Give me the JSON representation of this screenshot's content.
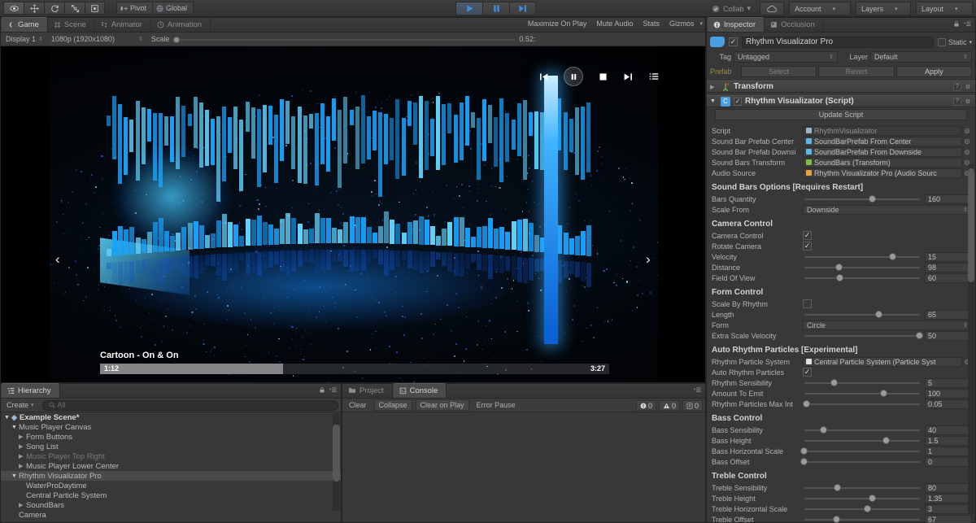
{
  "toolbar": {
    "tools": [
      "hand-tool",
      "move-tool",
      "rotate-tool",
      "scale-tool",
      "rect-tool"
    ],
    "pivot_label": "Pivot",
    "global_label": "Global",
    "play_label": "play",
    "pause_label": "pause",
    "step_label": "step",
    "collab_label": "Collab",
    "cloud_label": "cloud-services",
    "account_label": "Account",
    "layers_label": "Layers",
    "layout_label": "Layout",
    "caret": "▾"
  },
  "game": {
    "tabs": [
      {
        "label": "Game",
        "icon": "game-icon",
        "active": true
      },
      {
        "label": "Scene",
        "icon": "scene-icon",
        "active": false
      },
      {
        "label": "Animator",
        "icon": "animator-icon",
        "active": false
      },
      {
        "label": "Animation",
        "icon": "animation-icon",
        "active": false
      }
    ],
    "display": "Display 1",
    "resolution": "1080p (1920x1080)",
    "scale_label": "Scale",
    "scale_value": "0.52:",
    "maximize_on_play": "Maximize On Play",
    "mute_audio": "Mute Audio",
    "stats": "Stats",
    "gizmos": "Gizmos",
    "player": {
      "song_title": "Cartoon - On & On",
      "current_time": "1:12",
      "total_time": "3:27",
      "progress_percent": 36,
      "controls": [
        "previous-icon",
        "pause-icon",
        "stop-icon",
        "next-icon",
        "playlist-icon"
      ]
    },
    "nav_left": "‹",
    "nav_right": "›"
  },
  "hierarchy": {
    "tab_label": "Hierarchy",
    "create_label": "Create",
    "search_placeholder": "All",
    "items": [
      {
        "label": "Example Scene*",
        "depth": 0,
        "arrow": "open",
        "style": "scene"
      },
      {
        "label": "Music Player Canvas",
        "depth": 1,
        "arrow": "open",
        "style": "normal"
      },
      {
        "label": "Form Buttons",
        "depth": 2,
        "arrow": "closed",
        "style": "normal"
      },
      {
        "label": "Song List",
        "depth": 2,
        "arrow": "closed",
        "style": "normal"
      },
      {
        "label": "Music Player Top Right",
        "depth": 2,
        "arrow": "closed",
        "style": "dim"
      },
      {
        "label": "Music Player Lower Center",
        "depth": 2,
        "arrow": "closed",
        "style": "normal"
      },
      {
        "label": "Rhythm Visualizator Pro",
        "depth": 1,
        "arrow": "open",
        "style": "selected"
      },
      {
        "label": "WaterProDaytime",
        "depth": 2,
        "arrow": "none",
        "style": "normal"
      },
      {
        "label": "Central Particle System",
        "depth": 2,
        "arrow": "none",
        "style": "normal"
      },
      {
        "label": "SoundBars",
        "depth": 2,
        "arrow": "closed",
        "style": "normal"
      },
      {
        "label": "Camera",
        "depth": 1,
        "arrow": "none",
        "style": "normal"
      }
    ]
  },
  "console": {
    "tabs": [
      {
        "label": "Project",
        "icon": "folder-icon",
        "active": false
      },
      {
        "label": "Console",
        "icon": "console-icon",
        "active": true
      }
    ],
    "clear": "Clear",
    "collapse": "Collapse",
    "clear_on_play": "Clear on Play",
    "error_pause": "Error Pause",
    "counts": [
      {
        "icon": "error-icon",
        "value": "0"
      },
      {
        "icon": "warning-icon",
        "value": "0"
      },
      {
        "icon": "info-icon",
        "value": "0"
      }
    ]
  },
  "inspector": {
    "tabs": [
      {
        "label": "Inspector",
        "icon": "inspector-icon",
        "active": true
      },
      {
        "label": "Occlusion",
        "icon": "occlusion-icon",
        "active": false
      }
    ],
    "object_name": "Rhythm Visualizator Pro",
    "enabled": true,
    "static_label": "Static",
    "tag_label": "Tag",
    "tag_value": "Untagged",
    "layer_label": "Layer",
    "layer_value": "Default",
    "prefab_label": "Prefab",
    "prefab_select": "Select",
    "prefab_revert": "Revert",
    "prefab_apply": "Apply",
    "components": [
      {
        "name": "Transform",
        "icon_color": "#7ac043",
        "expanded": false,
        "has_checkbox": false
      },
      {
        "name": "Rhythm Visualizator (Script)",
        "icon_color": "#4a9fe0",
        "expanded": true,
        "has_checkbox": true,
        "checked": true
      }
    ],
    "update_script_label": "Update Script",
    "object_fields": [
      {
        "label": "Script",
        "value": "RhythmVisualizator",
        "dot": "#9bb4cc",
        "readonly": true
      },
      {
        "label": "Sound Bar Prefab Center",
        "value": "SoundBarPrefab From Center",
        "dot": "#59b9e8",
        "readonly": false
      },
      {
        "label": "Sound Bar Prefab Downsi",
        "value": "SoundBarPrefab From Downside",
        "dot": "#59b9e8",
        "readonly": false
      },
      {
        "label": "Sound Bars Transform",
        "value": "SoundBars (Transform)",
        "dot": "#7ac043",
        "readonly": false
      },
      {
        "label": "Audio Source",
        "value": "Rhythm Visualizator Pro (Audio Sourc",
        "dot": "#e8a33d",
        "readonly": false
      }
    ],
    "sections": [
      {
        "title": "Sound Bars Options [Requires Restart]",
        "rows": [
          {
            "type": "slider",
            "label": "Bars Quantity",
            "value": "160",
            "pos": 58
          },
          {
            "type": "dropdown",
            "label": "Scale From",
            "value": "Downside"
          }
        ]
      },
      {
        "title": "Camera Control",
        "rows": [
          {
            "type": "checkbox",
            "label": "Camera Control",
            "checked": true
          },
          {
            "type": "checkbox",
            "label": "Rotate Camera",
            "checked": true
          },
          {
            "type": "slider",
            "label": "Velocity",
            "value": "15",
            "pos": 75
          },
          {
            "type": "slider",
            "label": "Distance",
            "value": "98",
            "pos": 30
          },
          {
            "type": "slider",
            "label": "Field Of View",
            "value": "60",
            "pos": 31
          }
        ]
      },
      {
        "title": "Form Control",
        "rows": [
          {
            "type": "checkbox",
            "label": "Scale By Rhythm",
            "checked": false
          },
          {
            "type": "slider",
            "label": "Length",
            "value": "65",
            "pos": 64
          },
          {
            "type": "dropdown",
            "label": "Form",
            "value": "Circle"
          },
          {
            "type": "slider",
            "label": "Extra Scale Velocity",
            "value": "50",
            "pos": 98
          }
        ]
      },
      {
        "title": "Auto Rhythm Particles [Experimental]",
        "rows": [
          {
            "type": "object",
            "label": "Rhythm Particle System",
            "value": "Central Particle System (Particle Syst",
            "dot": "#e0e0e0"
          },
          {
            "type": "checkbox",
            "label": "Auto Rhythm Particles",
            "checked": true
          },
          {
            "type": "slider",
            "label": "Rhythm Sensibility",
            "value": "5",
            "pos": 26
          },
          {
            "type": "slider",
            "label": "Amount To Emit",
            "value": "100",
            "pos": 68
          },
          {
            "type": "slider",
            "label": "Rhythm Particles Max Int",
            "value": "0.05",
            "pos": 3
          }
        ]
      },
      {
        "title": "Bass Control",
        "rows": [
          {
            "type": "slider",
            "label": "Bass Sensibility",
            "value": "40",
            "pos": 17
          },
          {
            "type": "slider",
            "label": "Bass Height",
            "value": "1.5",
            "pos": 70
          },
          {
            "type": "slider",
            "label": "Bass Horizontal Scale",
            "value": "1",
            "pos": 1
          },
          {
            "type": "slider",
            "label": "Bass Offset",
            "value": "0",
            "pos": 1
          }
        ]
      },
      {
        "title": "Treble Control",
        "rows": [
          {
            "type": "slider",
            "label": "Treble Sensibility",
            "value": "80",
            "pos": 29
          },
          {
            "type": "slider",
            "label": "Treble Height",
            "value": "1.35",
            "pos": 58
          },
          {
            "type": "slider",
            "label": "Treble Horizontal Scale",
            "value": "3",
            "pos": 54
          },
          {
            "type": "slider",
            "label": "Treble Offset",
            "value": "67",
            "pos": 28
          }
        ]
      }
    ]
  },
  "colors": {
    "accent_blue": "#17a4ff",
    "panel_bg": "#383838",
    "toolbar_bg": "#3c3c3c",
    "selected_row": "#4a4a4a"
  }
}
